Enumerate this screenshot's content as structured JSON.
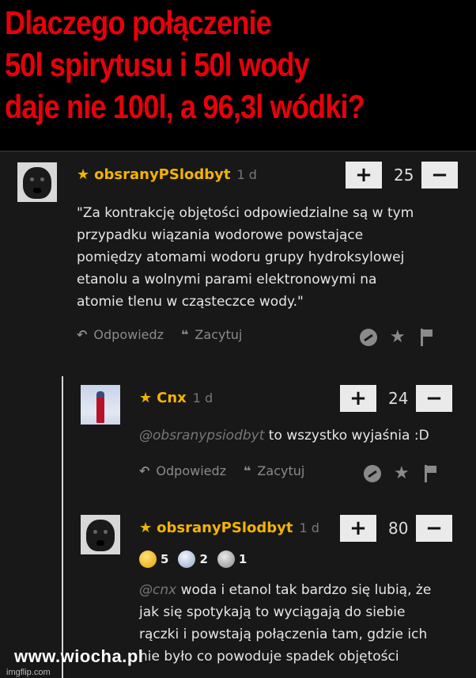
{
  "headline": {
    "line1": "Dlaczego połączenie",
    "line2": "50l spirytusu i 50l wody",
    "line3": "daje nie 100l, a 96,3l wódki?"
  },
  "comments": [
    {
      "username": "obsranyPSlodbyt",
      "age": "1 d",
      "votes": "25",
      "plus": "+",
      "minus": "−",
      "lines": [
        "\"Za kontrakcję objętości odpowiedzialne są w tym",
        "przypadku wiązania wodorowe powstające",
        "pomiędzy atomami wodoru grupy hydroksylowej",
        "etanolu a wolnymi parami elektronowymi na",
        "atomie tlenu w cząsteczce wody.\""
      ],
      "reply_label": "Odpowiedz",
      "quote_label": "Zacytuj"
    },
    {
      "username": "Cnx",
      "age": "1 d",
      "votes": "24",
      "plus": "+",
      "minus": "−",
      "mention": "@obsranypsiodbyt",
      "text": "to wszystko wyjaśnia :D",
      "reply_label": "Odpowiedz",
      "quote_label": "Zacytuj"
    },
    {
      "username": "obsranyPSlodbyt",
      "age": "1 d",
      "votes": "80",
      "plus": "+",
      "minus": "−",
      "badges": {
        "gold": "5",
        "silver": "2",
        "bronze": "1"
      },
      "mention": "@cnx",
      "first_line": "woda i etanol tak bardzo się lubią, że",
      "lines": [
        "jak się spotykają to wyciągają do siebie",
        "rączki i powstają połączenia tam, gdzie ich",
        "nie było co powoduje spadek objętości"
      ]
    }
  ],
  "icons": {
    "star": "★",
    "reply": "↶",
    "quote": "❝"
  },
  "footer": {
    "watermark": "www.wiocha.pl",
    "imgflip": "imgflip.com"
  },
  "colors": {
    "headline": "#e8000b",
    "username": "#f4b400",
    "panel": "#181818"
  }
}
